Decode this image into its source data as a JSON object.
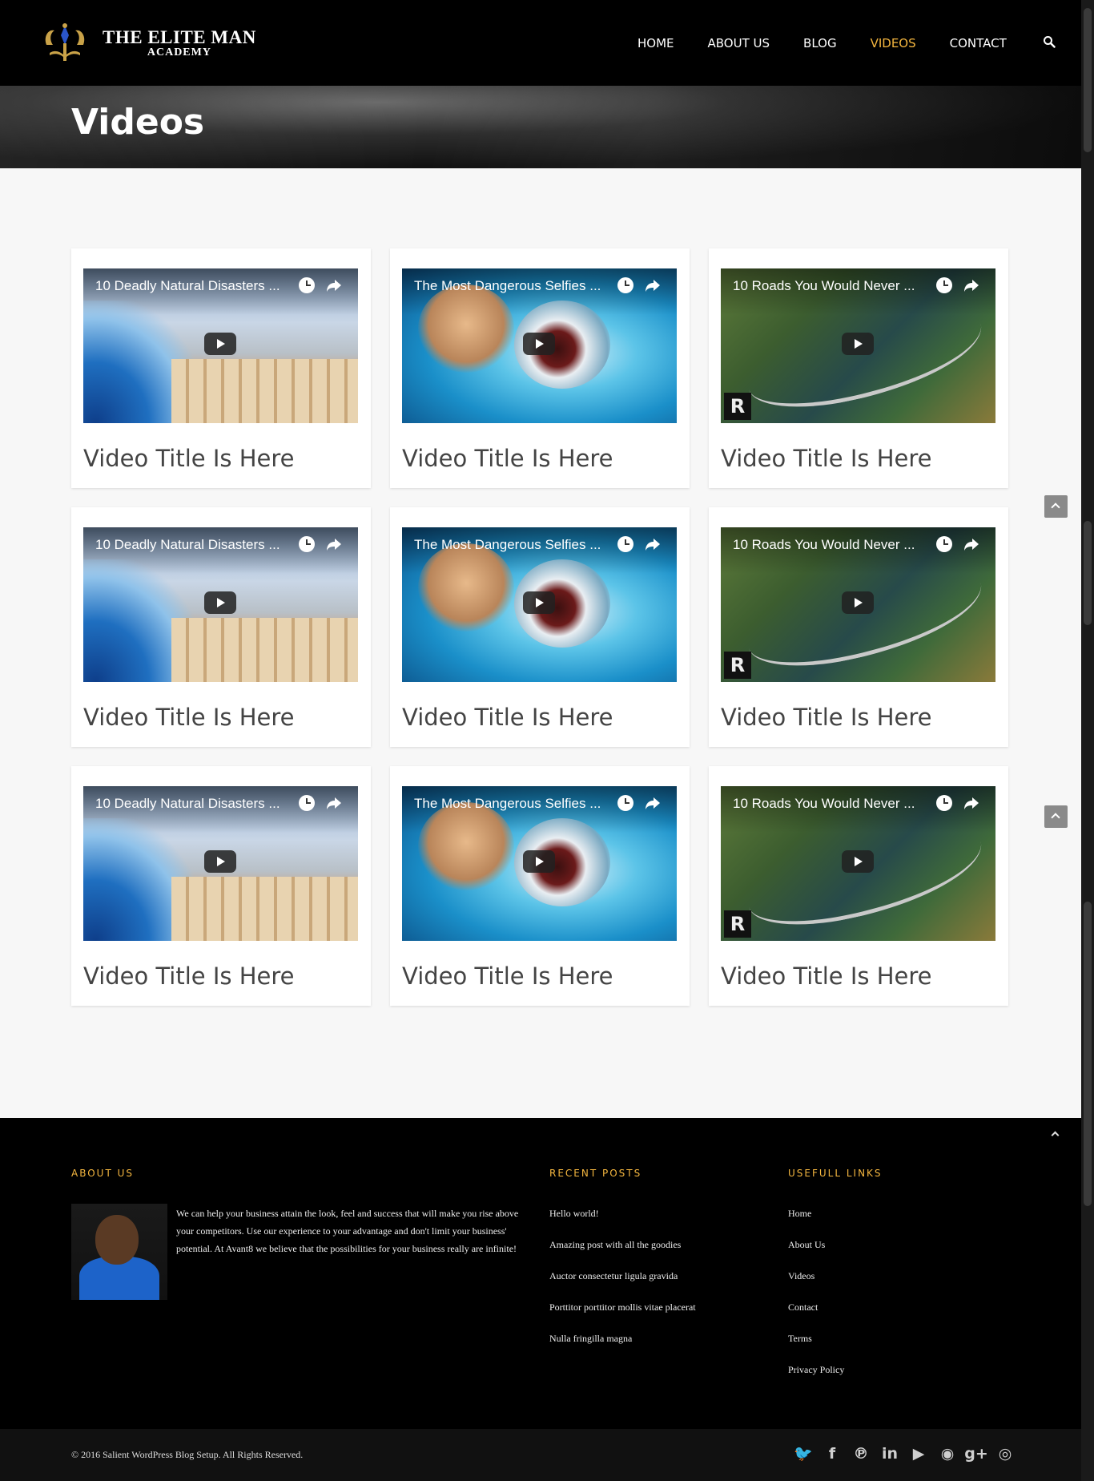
{
  "brand": {
    "line1": "THE ELITE MAN",
    "line2": "ACADEMY"
  },
  "nav": {
    "items": [
      {
        "label": "HOME",
        "active": false
      },
      {
        "label": "ABOUT US",
        "active": false
      },
      {
        "label": "BLOG",
        "active": false
      },
      {
        "label": "VIDEOS",
        "active": true
      },
      {
        "label": "CONTACT",
        "active": false
      }
    ],
    "search_icon": "search-icon"
  },
  "page": {
    "title": "Videos"
  },
  "videos": [
    {
      "thumb_title": "10 Deadly Natural Disasters ...",
      "title": "Video Title Is Here"
    },
    {
      "thumb_title": "The Most Dangerous Selfies ...",
      "title": "Video Title Is Here"
    },
    {
      "thumb_title": "10 Roads You Would Never ...",
      "title": "Video Title Is Here"
    },
    {
      "thumb_title": "10 Deadly Natural Disasters ...",
      "title": "Video Title Is Here"
    },
    {
      "thumb_title": "The Most Dangerous Selfies ...",
      "title": "Video Title Is Here"
    },
    {
      "thumb_title": "10 Roads You Would Never ...",
      "title": "Video Title Is Here"
    },
    {
      "thumb_title": "10 Deadly Natural Disasters ...",
      "title": "Video Title Is Here"
    },
    {
      "thumb_title": "The Most Dangerous Selfies ...",
      "title": "Video Title Is Here"
    },
    {
      "thumb_title": "10 Roads You Would Never ...",
      "title": "Video Title Is Here"
    }
  ],
  "footer": {
    "about": {
      "heading": "ABOUT US",
      "text": "We can help your business attain the look, feel and success that will make you rise above your competitors. Use our experience to your advantage and don't limit your business' potential. At Avant8 we believe that the possibilities for your business really are infinite!"
    },
    "recent_posts": {
      "heading": "RECENT POSTS",
      "items": [
        "Hello world!",
        "Amazing post with all the goodies",
        "Auctor consectetur ligula gravida",
        "Porttitor porttitor mollis vitae placerat",
        "Nulla fringilla magna"
      ]
    },
    "useful_links": {
      "heading": "USEFULL LINKS",
      "items": [
        "Home",
        "About Us",
        "Videos",
        "Contact",
        "Terms",
        "Privacy Policy"
      ]
    },
    "copyright": "© 2016 Salient WordPress Blog Setup. All Rights Reserved.",
    "socials": [
      {
        "icon": "twitter-icon",
        "glyph": "🐦"
      },
      {
        "icon": "facebook-icon",
        "glyph": "f"
      },
      {
        "icon": "pinterest-icon",
        "glyph": "℗"
      },
      {
        "icon": "linkedin-icon",
        "glyph": "in"
      },
      {
        "icon": "youtube-icon",
        "glyph": "▶"
      },
      {
        "icon": "rss-icon",
        "glyph": "◉"
      },
      {
        "icon": "google-plus-icon",
        "glyph": "g+"
      },
      {
        "icon": "instagram-icon",
        "glyph": "◎"
      }
    ]
  },
  "colors": {
    "accent": "#f4b63f",
    "header_bg": "#000000",
    "page_bg": "#f7f7f7"
  }
}
